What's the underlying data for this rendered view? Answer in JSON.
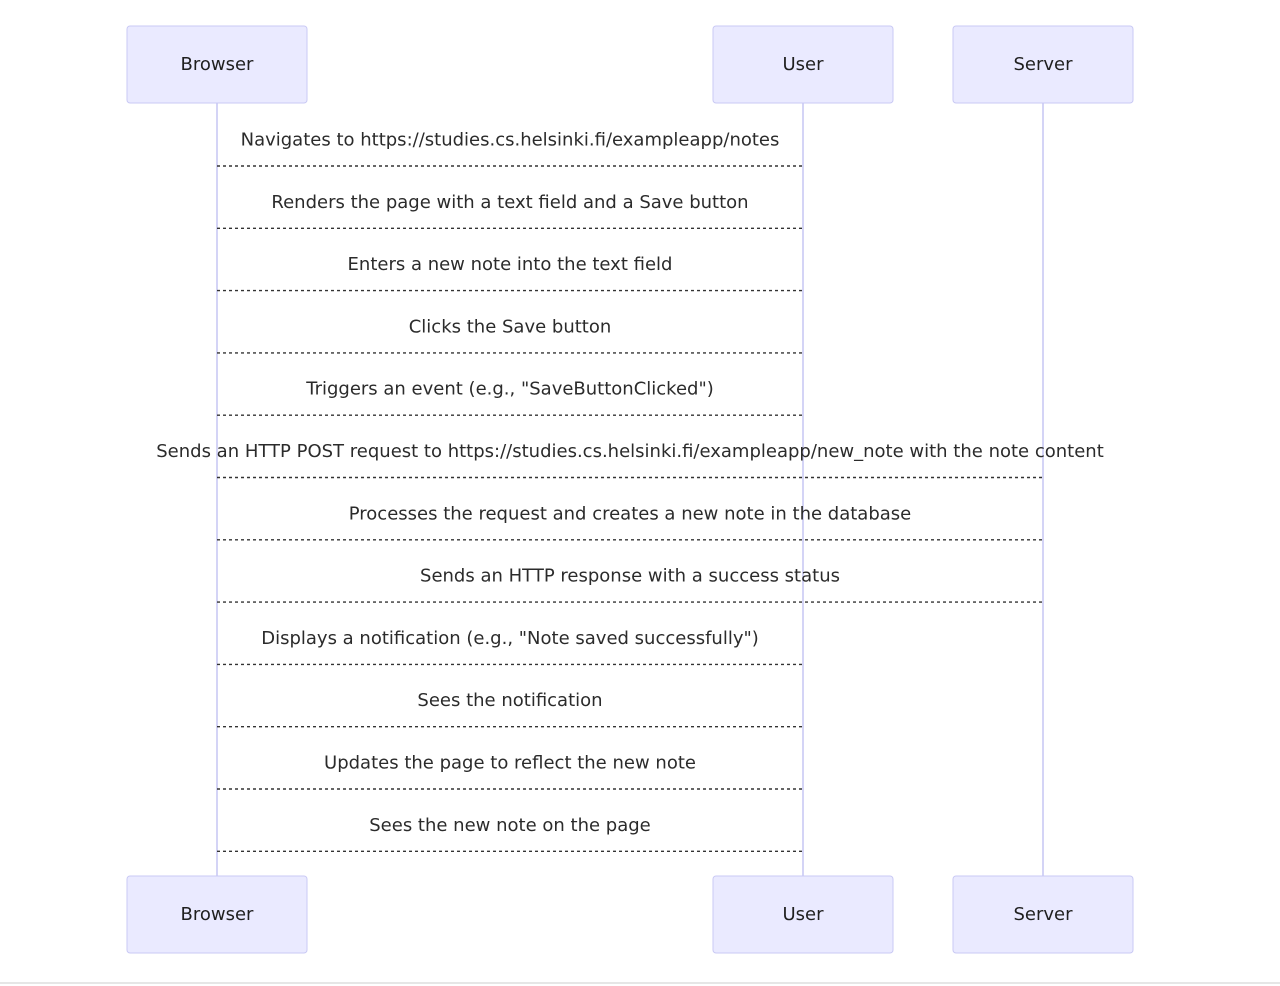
{
  "diagram": {
    "type": "sequence",
    "actors": [
      {
        "id": "browser",
        "label": "Browser"
      },
      {
        "id": "user",
        "label": "User"
      },
      {
        "id": "server",
        "label": "Server"
      }
    ],
    "messages": [
      {
        "from": "browser",
        "to": "user",
        "text": "Navigates to https://studies.cs.helsinki.fi/exampleapp/notes"
      },
      {
        "from": "browser",
        "to": "user",
        "text": "Renders the page with a text field and a Save button"
      },
      {
        "from": "browser",
        "to": "user",
        "text": "Enters a new note into the text field"
      },
      {
        "from": "browser",
        "to": "user",
        "text": "Clicks the Save button"
      },
      {
        "from": "browser",
        "to": "user",
        "text": "Triggers an event (e.g., \"SaveButtonClicked\")"
      },
      {
        "from": "browser",
        "to": "server",
        "text": "Sends an HTTP POST request to https://studies.cs.helsinki.fi/exampleapp/new_note with the note content"
      },
      {
        "from": "browser",
        "to": "server",
        "text": "Processes the request and creates a new note in the database"
      },
      {
        "from": "browser",
        "to": "server",
        "text": "Sends an HTTP response with a success status"
      },
      {
        "from": "browser",
        "to": "user",
        "text": "Displays a notification (e.g., \"Note saved successfully\")"
      },
      {
        "from": "browser",
        "to": "user",
        "text": "Sees the notification"
      },
      {
        "from": "browser",
        "to": "user",
        "text": "Updates the page to reflect the new note"
      },
      {
        "from": "browser",
        "to": "user",
        "text": "Sees the new note on the page"
      }
    ]
  },
  "colors": {
    "actor_fill": "#eaeaff",
    "actor_border": "#c9c9f4",
    "lifeline": "#d4d4f6",
    "message_line": "#333333",
    "text": "#2b2b2b"
  }
}
